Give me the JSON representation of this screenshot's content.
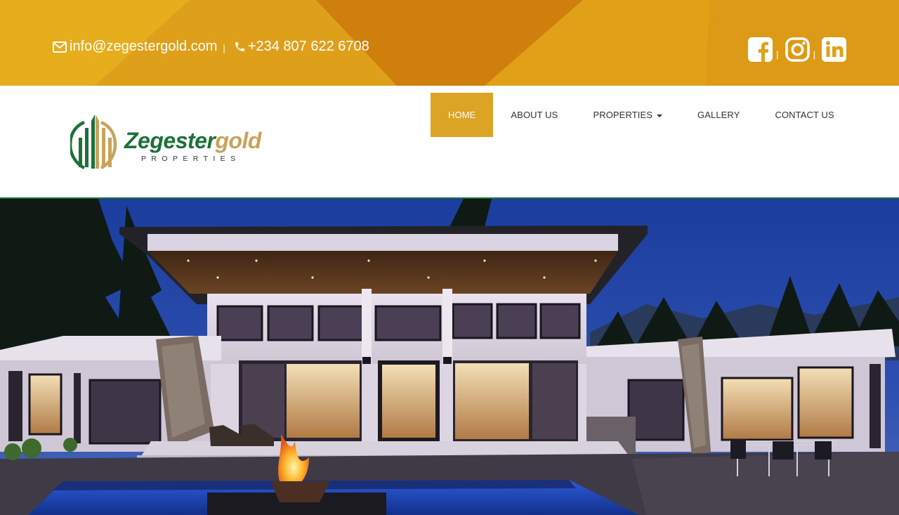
{
  "topbar": {
    "email": "info@zegestergold.com",
    "phone": "+234 807 622 6708",
    "separator": "|",
    "icons": {
      "email": "envelope-icon",
      "phone": "phone-icon",
      "facebook": "facebook-icon",
      "instagram": "instagram-icon",
      "linkedin": "linkedin-icon"
    }
  },
  "logo": {
    "brand_primary": "Zegester",
    "brand_secondary": "gold",
    "tagline": "PROPERTIES"
  },
  "nav": {
    "items": [
      {
        "label": "HOME",
        "active": true
      },
      {
        "label": "ABOUT US",
        "active": false
      },
      {
        "label": "PROPERTIES",
        "active": false,
        "has_dropdown": true
      },
      {
        "label": "GALLERY",
        "active": false
      },
      {
        "label": "CONTACT US",
        "active": false
      }
    ]
  },
  "colors": {
    "gold": "#dba424",
    "gold_bar": "#e0a219",
    "green": "#1c7138",
    "logo_gold": "#c9a25c",
    "night_sky": "#1a3a9c"
  }
}
